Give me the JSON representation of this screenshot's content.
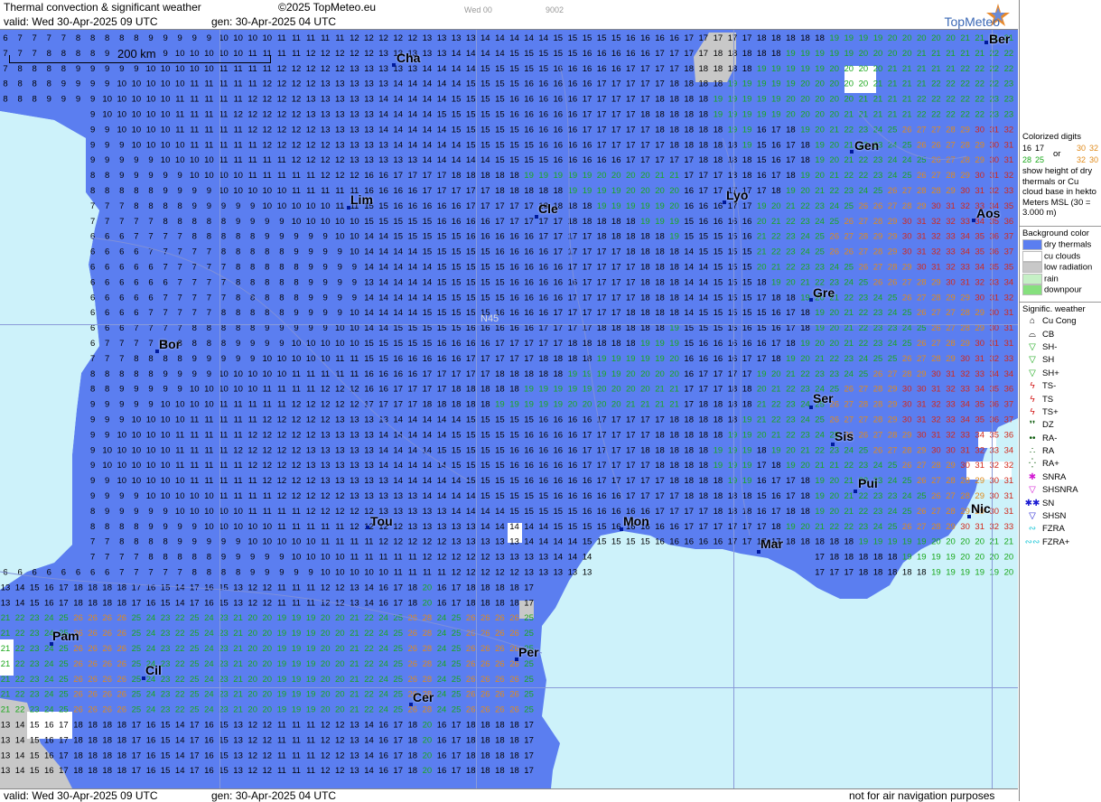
{
  "header": {
    "title": "Thermal convection & significant weather",
    "copyright": "©2025 TopMeteo.eu",
    "run_tag": "Wed 00",
    "code": "9002",
    "valid": "valid:  Wed  30-Apr-2025  09 UTC",
    "gen": "gen: 30-Apr-2025 04 UTC",
    "logo": "TopMeteo"
  },
  "footer": {
    "valid": "valid:  Wed  30-Apr-2025  09 UTC",
    "gen": "gen: 30-Apr-2025 04 UTC",
    "disclaimer": "not for air navigation purposes"
  },
  "map": {
    "scale_label": "200 km",
    "grid_label": "N45",
    "cities": [
      "Cha",
      "Ber",
      "Gen",
      "Lim",
      "Cle",
      "Lyo",
      "Aos",
      "Gre",
      "Bor",
      "Ser",
      "Sis",
      "Pui",
      "Tou",
      "Mon",
      "Mar",
      "Nic",
      "Pam",
      "Per",
      "Cil",
      "Cer"
    ]
  },
  "legend": {
    "colorized_title": "Colorized digits",
    "sample_a1": "16",
    "sample_a2": "17",
    "sample_b1": "28",
    "sample_b2": "25",
    "or": "or",
    "sample_c1": "30",
    "sample_c2": "32",
    "sample_d1": "32",
    "sample_d2": "30",
    "desc": "show height of dry thermals or Cu cloud base in hekto Meters MSL (30 = 3.000 m)",
    "bg_title": "Background color",
    "bg_items": [
      {
        "label": "dry thermals",
        "color": "#5b7ef0"
      },
      {
        "label": "cu clouds",
        "color": "#ffffff"
      },
      {
        "label": "low radiation",
        "color": "#c8c8c8"
      },
      {
        "label": "rain",
        "color": "#c5f0c5"
      },
      {
        "label": "downpour",
        "color": "#86e07e"
      }
    ],
    "wx_title": "Signific. weather",
    "wx_items": [
      {
        "label": "Cu Cong",
        "symbol": "⌂",
        "color": "#000"
      },
      {
        "label": "CB",
        "symbol": "⌓",
        "color": "#000"
      },
      {
        "label": "SH-",
        "symbol": "▽",
        "color": "#1aa81a"
      },
      {
        "label": "SH",
        "symbol": "▽",
        "color": "#1aa81a"
      },
      {
        "label": "SH+",
        "symbol": "▽",
        "color": "#1aa81a"
      },
      {
        "label": "TS-",
        "symbol": "ϟ",
        "color": "#d21a1a"
      },
      {
        "label": "TS",
        "symbol": "ϟ",
        "color": "#d21a1a"
      },
      {
        "label": "TS+",
        "symbol": "ϟ",
        "color": "#d21a1a"
      },
      {
        "label": "DZ",
        "symbol": "❜❜",
        "color": "#0a5a0a"
      },
      {
        "label": "RA-",
        "symbol": "••",
        "color": "#0a5a0a"
      },
      {
        "label": "RA",
        "symbol": "∴",
        "color": "#0a5a0a"
      },
      {
        "label": "RA+",
        "symbol": "⁛",
        "color": "#0a5a0a"
      },
      {
        "label": "SNRA",
        "symbol": "✱",
        "color": "#d21ad2"
      },
      {
        "label": "SHSNRA",
        "symbol": "▽",
        "color": "#d21ad2"
      },
      {
        "label": "SN",
        "symbol": "✱✱",
        "color": "#1a1ad2"
      },
      {
        "label": "SHSN",
        "symbol": "▽",
        "color": "#1a1ad2"
      },
      {
        "label": "FZRA",
        "symbol": "∾",
        "color": "#22c8d8"
      },
      {
        "label": "FZRA+",
        "symbol": "∾∾",
        "color": "#22c8d8"
      }
    ]
  }
}
